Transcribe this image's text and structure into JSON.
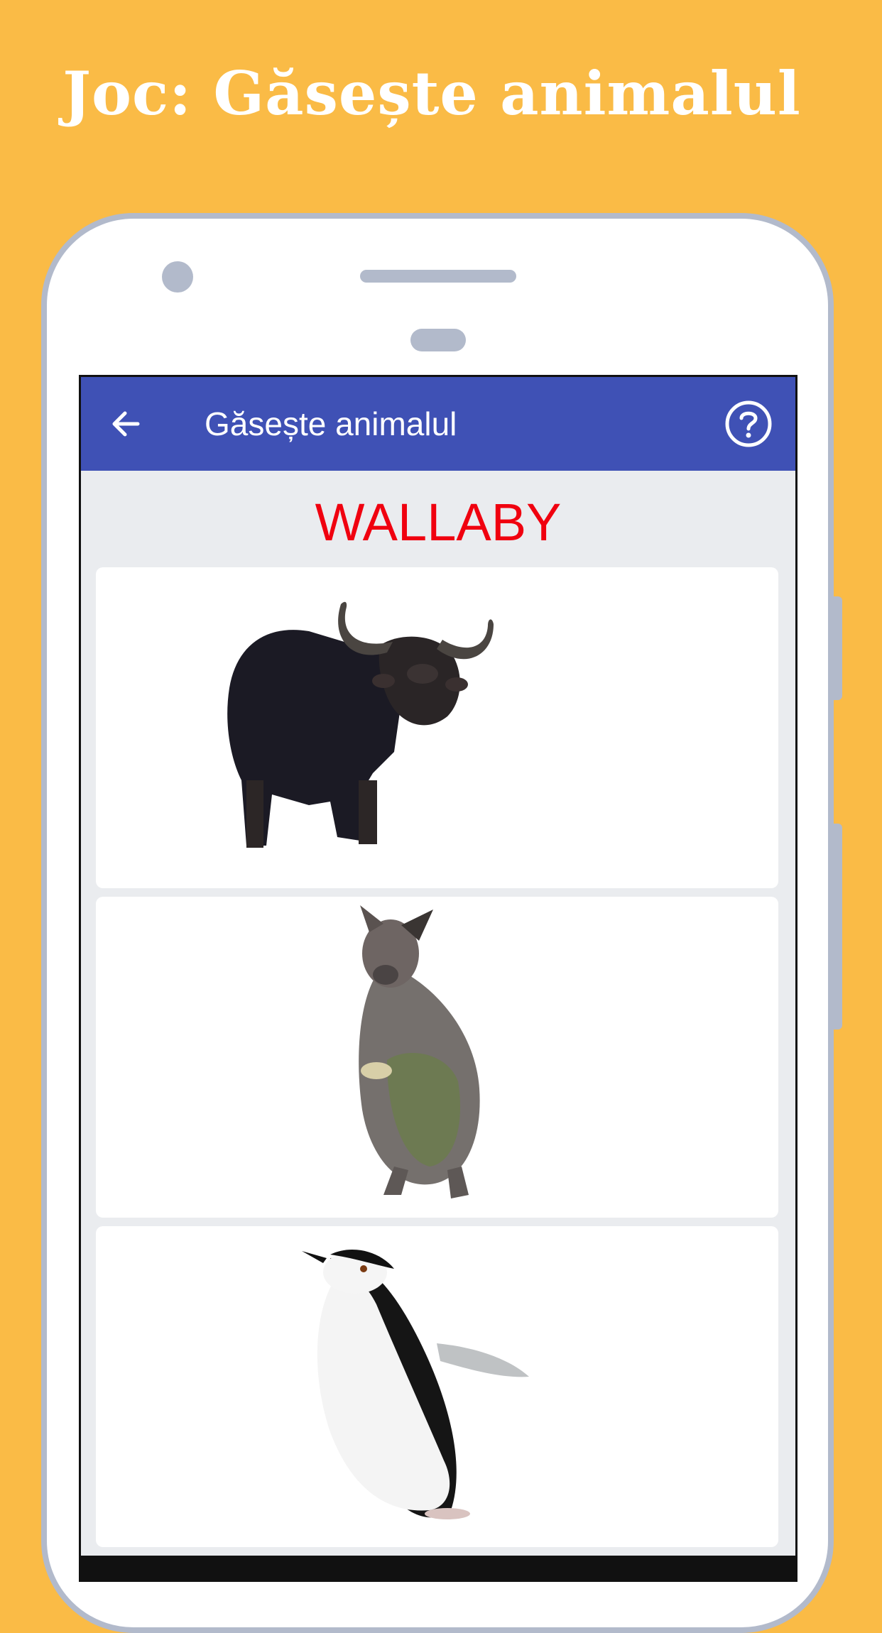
{
  "promo": {
    "title": "Joc: Găsește animalul"
  },
  "app_bar": {
    "title": "Găsește animalul",
    "back_icon": "arrow-back-icon",
    "help_icon": "help-circle-icon"
  },
  "game": {
    "target_word": "WALLABY",
    "target_color": "#F0000F",
    "options": [
      {
        "animal": "buffalo-image"
      },
      {
        "animal": "wallaby-image"
      },
      {
        "animal": "penguin-image"
      }
    ]
  },
  "colors": {
    "background": "#FABB46",
    "app_bar": "#3F51B5",
    "screen_bg": "#EAECEF",
    "phone_frame": "#B2BACB"
  }
}
